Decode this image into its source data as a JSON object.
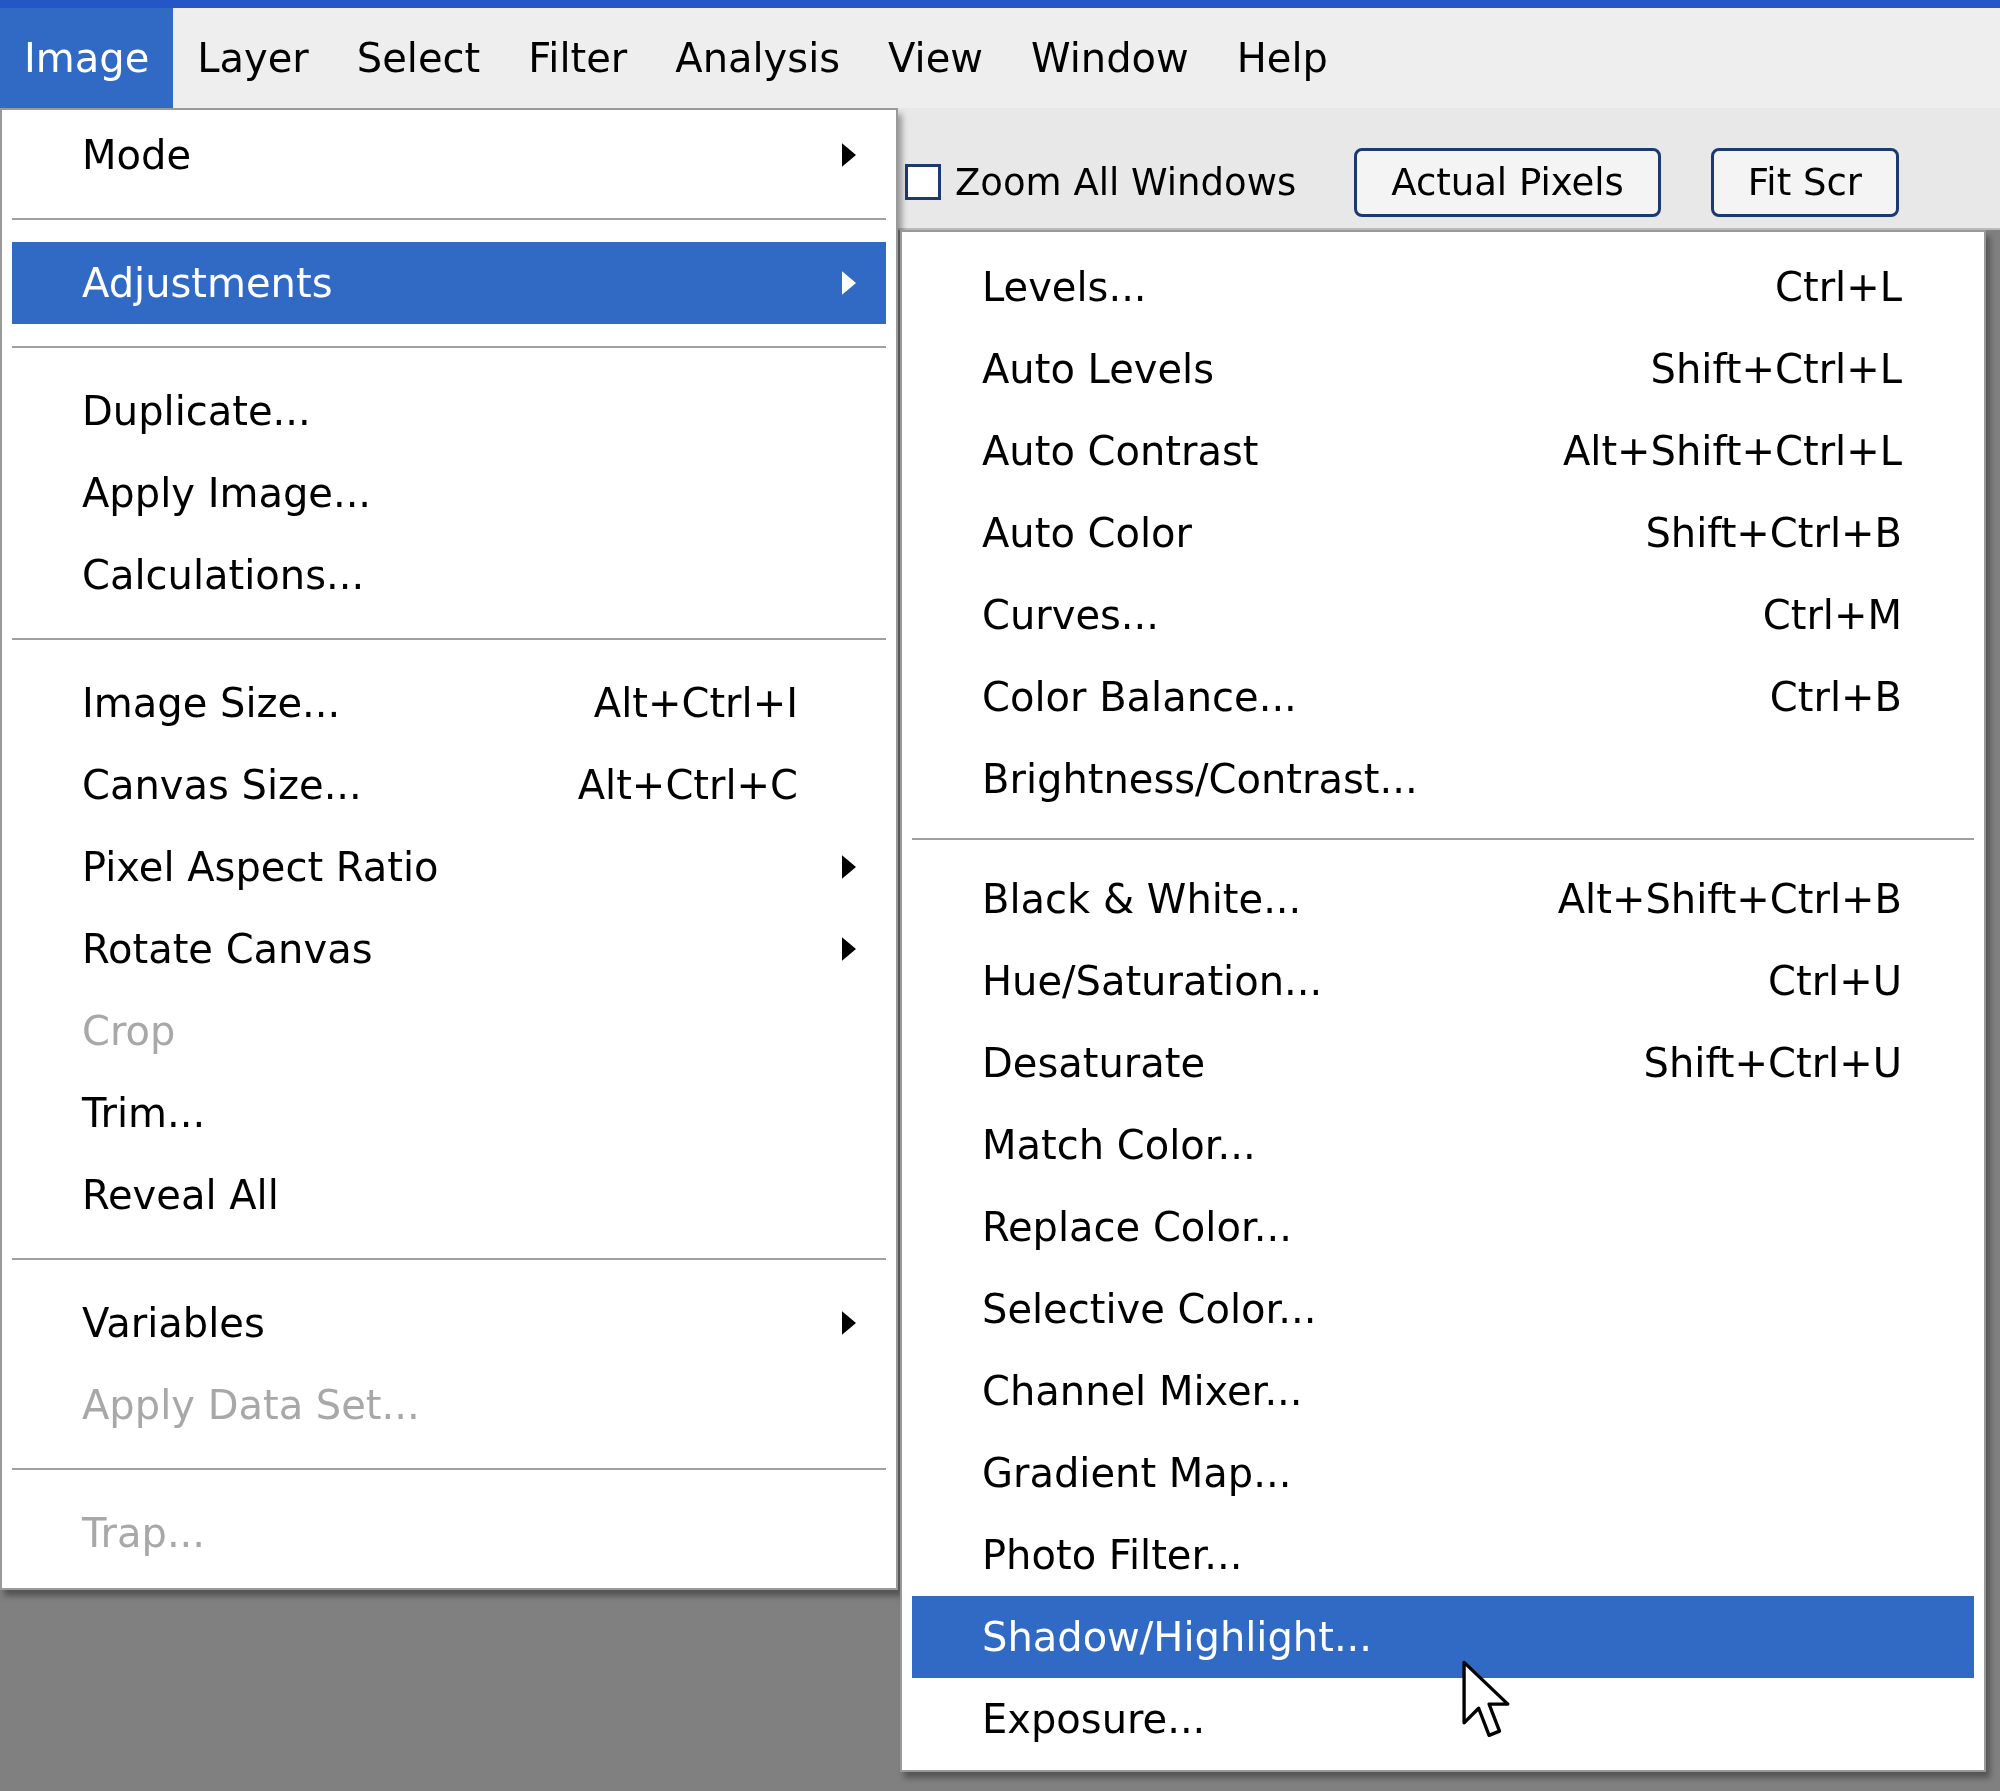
{
  "menubar": [
    {
      "label": "Image",
      "selected": true
    },
    {
      "label": "Layer",
      "selected": false
    },
    {
      "label": "Select",
      "selected": false
    },
    {
      "label": "Filter",
      "selected": false
    },
    {
      "label": "Analysis",
      "selected": false
    },
    {
      "label": "View",
      "selected": false
    },
    {
      "label": "Window",
      "selected": false
    },
    {
      "label": "Help",
      "selected": false
    }
  ],
  "toolbar": {
    "zoom_all_windows": {
      "label": "Zoom All Windows",
      "checked": false
    },
    "buttons": [
      "Actual Pixels",
      "Fit Scr"
    ]
  },
  "image_menu": [
    [
      {
        "label": "Mode",
        "submenu": true,
        "disabled": false,
        "selected": false
      }
    ],
    [
      {
        "label": "Adjustments",
        "submenu": true,
        "disabled": false,
        "selected": true
      }
    ],
    [
      {
        "label": "Duplicate...",
        "submenu": false,
        "disabled": false,
        "selected": false
      },
      {
        "label": "Apply Image...",
        "submenu": false,
        "disabled": false,
        "selected": false
      },
      {
        "label": "Calculations...",
        "submenu": false,
        "disabled": false,
        "selected": false
      }
    ],
    [
      {
        "label": "Image Size...",
        "shortcut": "Alt+Ctrl+I",
        "submenu": false,
        "disabled": false,
        "selected": false
      },
      {
        "label": "Canvas Size...",
        "shortcut": "Alt+Ctrl+C",
        "submenu": false,
        "disabled": false,
        "selected": false
      },
      {
        "label": "Pixel Aspect Ratio",
        "submenu": true,
        "disabled": false,
        "selected": false
      },
      {
        "label": "Rotate Canvas",
        "submenu": true,
        "disabled": false,
        "selected": false
      },
      {
        "label": "Crop",
        "submenu": false,
        "disabled": true,
        "selected": false
      },
      {
        "label": "Trim...",
        "submenu": false,
        "disabled": false,
        "selected": false
      },
      {
        "label": "Reveal All",
        "submenu": false,
        "disabled": false,
        "selected": false
      }
    ],
    [
      {
        "label": "Variables",
        "submenu": true,
        "disabled": false,
        "selected": false
      },
      {
        "label": "Apply Data Set...",
        "submenu": false,
        "disabled": true,
        "selected": false
      }
    ],
    [
      {
        "label": "Trap...",
        "submenu": false,
        "disabled": true,
        "selected": false
      }
    ]
  ],
  "adjustments_menu": [
    [
      {
        "label": "Levels...",
        "shortcut": "Ctrl+L",
        "selected": false
      },
      {
        "label": "Auto Levels",
        "shortcut": "Shift+Ctrl+L",
        "selected": false
      },
      {
        "label": "Auto Contrast",
        "shortcut": "Alt+Shift+Ctrl+L",
        "selected": false
      },
      {
        "label": "Auto Color",
        "shortcut": "Shift+Ctrl+B",
        "selected": false
      },
      {
        "label": "Curves...",
        "shortcut": "Ctrl+M",
        "selected": false
      },
      {
        "label": "Color Balance...",
        "shortcut": "Ctrl+B",
        "selected": false
      },
      {
        "label": "Brightness/Contrast...",
        "selected": false
      }
    ],
    [
      {
        "label": "Black & White...",
        "shortcut": "Alt+Shift+Ctrl+B",
        "selected": false
      },
      {
        "label": "Hue/Saturation...",
        "shortcut": "Ctrl+U",
        "selected": false
      },
      {
        "label": "Desaturate",
        "shortcut": "Shift+Ctrl+U",
        "selected": false
      },
      {
        "label": "Match Color...",
        "selected": false
      },
      {
        "label": "Replace Color...",
        "selected": false
      },
      {
        "label": "Selective Color...",
        "selected": false
      },
      {
        "label": "Channel Mixer...",
        "selected": false
      },
      {
        "label": "Gradient Map...",
        "selected": false
      },
      {
        "label": "Photo Filter...",
        "selected": false
      },
      {
        "label": "Shadow/Highlight...",
        "selected": true
      },
      {
        "label": "Exposure...",
        "selected": false
      }
    ]
  ]
}
